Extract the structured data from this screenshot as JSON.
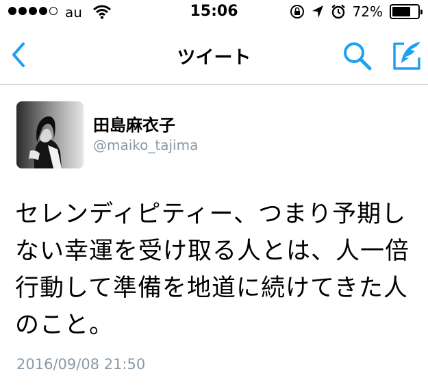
{
  "status_bar": {
    "carrier": "au",
    "time": "15:06",
    "battery_percent": "72%",
    "battery_level": 0.72,
    "signal_bars_filled": 4,
    "signal_bars_total": 5
  },
  "nav": {
    "title": "ツイート",
    "accent_color": "#1da1f2",
    "icons": [
      "chevron-left-icon",
      "search-icon",
      "compose-icon"
    ]
  },
  "tweet": {
    "author_name": "田島麻衣子",
    "author_handle": "@maiko_tajima",
    "text": "セレンディピティー、つまり予期しない幸運を受け取る人とは、人一倍行動して準備を地道に続けてきた人のこと。",
    "timestamp": "2016/09/08 21:50"
  }
}
